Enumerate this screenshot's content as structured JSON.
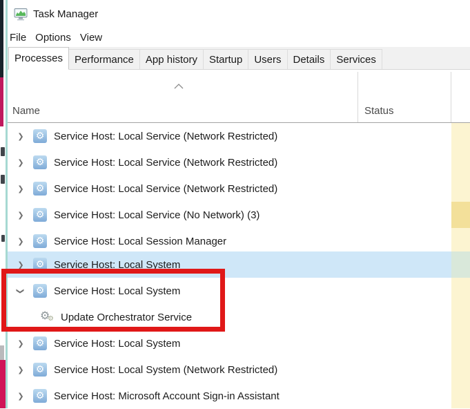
{
  "window": {
    "title": "Task Manager"
  },
  "menu": {
    "items": [
      "File",
      "Options",
      "View"
    ]
  },
  "tabs": {
    "items": [
      {
        "label": "Processes",
        "selected": true
      },
      {
        "label": "Performance",
        "selected": false
      },
      {
        "label": "App history",
        "selected": false
      },
      {
        "label": "Startup",
        "selected": false
      },
      {
        "label": "Users",
        "selected": false
      },
      {
        "label": "Details",
        "selected": false
      },
      {
        "label": "Services",
        "selected": false
      }
    ]
  },
  "table": {
    "columns": [
      {
        "label": "Name",
        "sort": "ascending"
      },
      {
        "label": "Status"
      }
    ],
    "rows": [
      {
        "name": "Service Host: Local Service (Network Restricted)",
        "expander": "collapsed",
        "level": 0,
        "icon": "service-gear-icon",
        "highlighted": false
      },
      {
        "name": "Service Host: Local Service (Network Restricted)",
        "expander": "collapsed",
        "level": 0,
        "icon": "service-gear-icon",
        "highlighted": false
      },
      {
        "name": "Service Host: Local Service (Network Restricted)",
        "expander": "collapsed",
        "level": 0,
        "icon": "service-gear-icon",
        "highlighted": false
      },
      {
        "name": "Service Host: Local Service (No Network) (3)",
        "expander": "collapsed",
        "level": 0,
        "icon": "service-gear-icon",
        "highlighted": false,
        "heat_cell": "darker"
      },
      {
        "name": "Service Host: Local Session Manager",
        "expander": "collapsed",
        "level": 0,
        "icon": "service-gear-icon",
        "highlighted": false
      },
      {
        "name": "Service Host: Local System",
        "expander": "collapsed",
        "level": 0,
        "icon": "service-gear-icon",
        "highlighted": true
      },
      {
        "name": "Service Host: Local System",
        "expander": "expanded",
        "level": 0,
        "icon": "service-gear-icon",
        "highlighted": false,
        "annotated": true
      },
      {
        "name": "Update Orchestrator Service",
        "expander": "none",
        "level": 1,
        "icon": "update-orchestrator-icon",
        "highlighted": false,
        "annotated": true
      },
      {
        "name": "Service Host: Local System",
        "expander": "collapsed",
        "level": 0,
        "icon": "service-gear-icon",
        "highlighted": false
      },
      {
        "name": "Service Host: Local System (Network Restricted)",
        "expander": "collapsed",
        "level": 0,
        "icon": "service-gear-icon",
        "highlighted": false
      },
      {
        "name": "Service Host: Microsoft Account Sign-in Assistant",
        "expander": "collapsed",
        "level": 0,
        "icon": "service-gear-icon",
        "highlighted": false
      }
    ]
  },
  "annotation": {
    "shape": "rectangle",
    "color": "#e01818"
  },
  "colors": {
    "highlight_row": "#cfe7f8",
    "heat_column": "#fcf4d1",
    "heat_column_darker": "#f3e09a",
    "tab_strip_bg": "#f1f1f1",
    "annotation_red": "#e01818"
  }
}
